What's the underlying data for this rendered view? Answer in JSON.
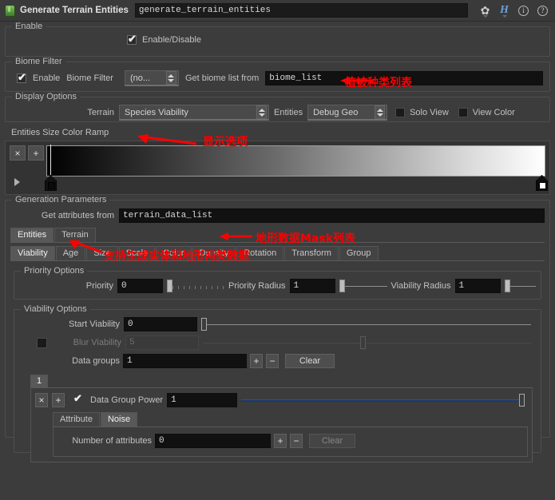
{
  "titlebar": {
    "node_icon": "terrain-node-icon",
    "title": "Generate Terrain Entities",
    "name_value": "generate_terrain_entities",
    "icons": [
      "gear-icon",
      "houdini-h-icon",
      "info-icon",
      "help-icon"
    ],
    "gear_glyph": "✿",
    "h_glyph": "H",
    "info_glyph": "i",
    "help_glyph": "?"
  },
  "enable_group": {
    "label": "Enable",
    "checkbox_label": "Enable/Disable",
    "checked": true
  },
  "biome_filter": {
    "label": "Biome Filter",
    "enable_label": "Enable",
    "enable_checked": true,
    "filter_label": "Biome Filter",
    "combo_value": "(no...",
    "get_list_label": "Get biome list from",
    "list_value": "biome_list",
    "annotation": "植被种类列表"
  },
  "display_options": {
    "label": "Display Options",
    "terrain_label": "Terrain",
    "terrain_value": "Species Viability",
    "entities_label": "Entities",
    "entities_value": "Debug Geo",
    "solo_view_label": "Solo View",
    "solo_view_checked": false,
    "view_color_label": "View Color",
    "view_color_checked": false,
    "ramp_label": "Entities Size Color Ramp",
    "annotation": "显示选项",
    "ramp": {
      "remove_label": "×",
      "add_label": "+",
      "stops": [
        {
          "position": 0,
          "color": "#000000"
        },
        {
          "position": 100,
          "color": "#ffffff"
        }
      ]
    }
  },
  "generation_parameters": {
    "label": "Generation Parameters",
    "get_attributes_label": "Get attributes from",
    "get_attributes_value": "terrain_data_list",
    "annotation": "地形数据Mask列表",
    "main_tabs": [
      {
        "label": "Entities",
        "active": true
      },
      {
        "label": "Terrain",
        "active": false
      }
    ],
    "main_tabs_annotation": "支持生成实体和地形两类数据",
    "sub_tabs": [
      {
        "label": "Viability",
        "active": true
      },
      {
        "label": "Age",
        "active": false
      },
      {
        "label": "Size",
        "active": false
      },
      {
        "label": "Scale",
        "active": false
      },
      {
        "label": "Color",
        "active": false
      },
      {
        "label": "Density",
        "active": false
      },
      {
        "label": "Rotation",
        "active": false
      },
      {
        "label": "Transform",
        "active": false
      },
      {
        "label": "Group",
        "active": false
      }
    ]
  },
  "priority_options": {
    "label": "Priority Options",
    "priority_label": "Priority",
    "priority_value": "0",
    "priority_radius_label": "Priority Radius",
    "priority_radius_value": "1",
    "viability_radius_label": "Viability Radius",
    "viability_radius_value": "1"
  },
  "viability_options": {
    "label": "Viability Options",
    "start_viability_label": "Start Viability",
    "start_viability_value": "0",
    "blur_viability_label": "Blur Viability",
    "blur_viability_value": "5",
    "blur_viability_enabled": false,
    "data_groups_label": "Data groups",
    "data_groups_value": "1",
    "add_label": "+",
    "remove_label": "−",
    "clear_label": "Clear"
  },
  "data_group": {
    "tab_label": "1",
    "remove_label": "×",
    "add_label": "+",
    "power_label": "Data Group Power",
    "power_checked": true,
    "power_value": "1",
    "inner_tabs": [
      {
        "label": "Attribute",
        "active": false
      },
      {
        "label": "Noise",
        "active": true
      }
    ],
    "num_attributes_label": "Number of attributes",
    "num_attributes_value": "0",
    "attr_add_label": "+",
    "attr_remove_label": "−",
    "attr_clear_label": "Clear"
  }
}
